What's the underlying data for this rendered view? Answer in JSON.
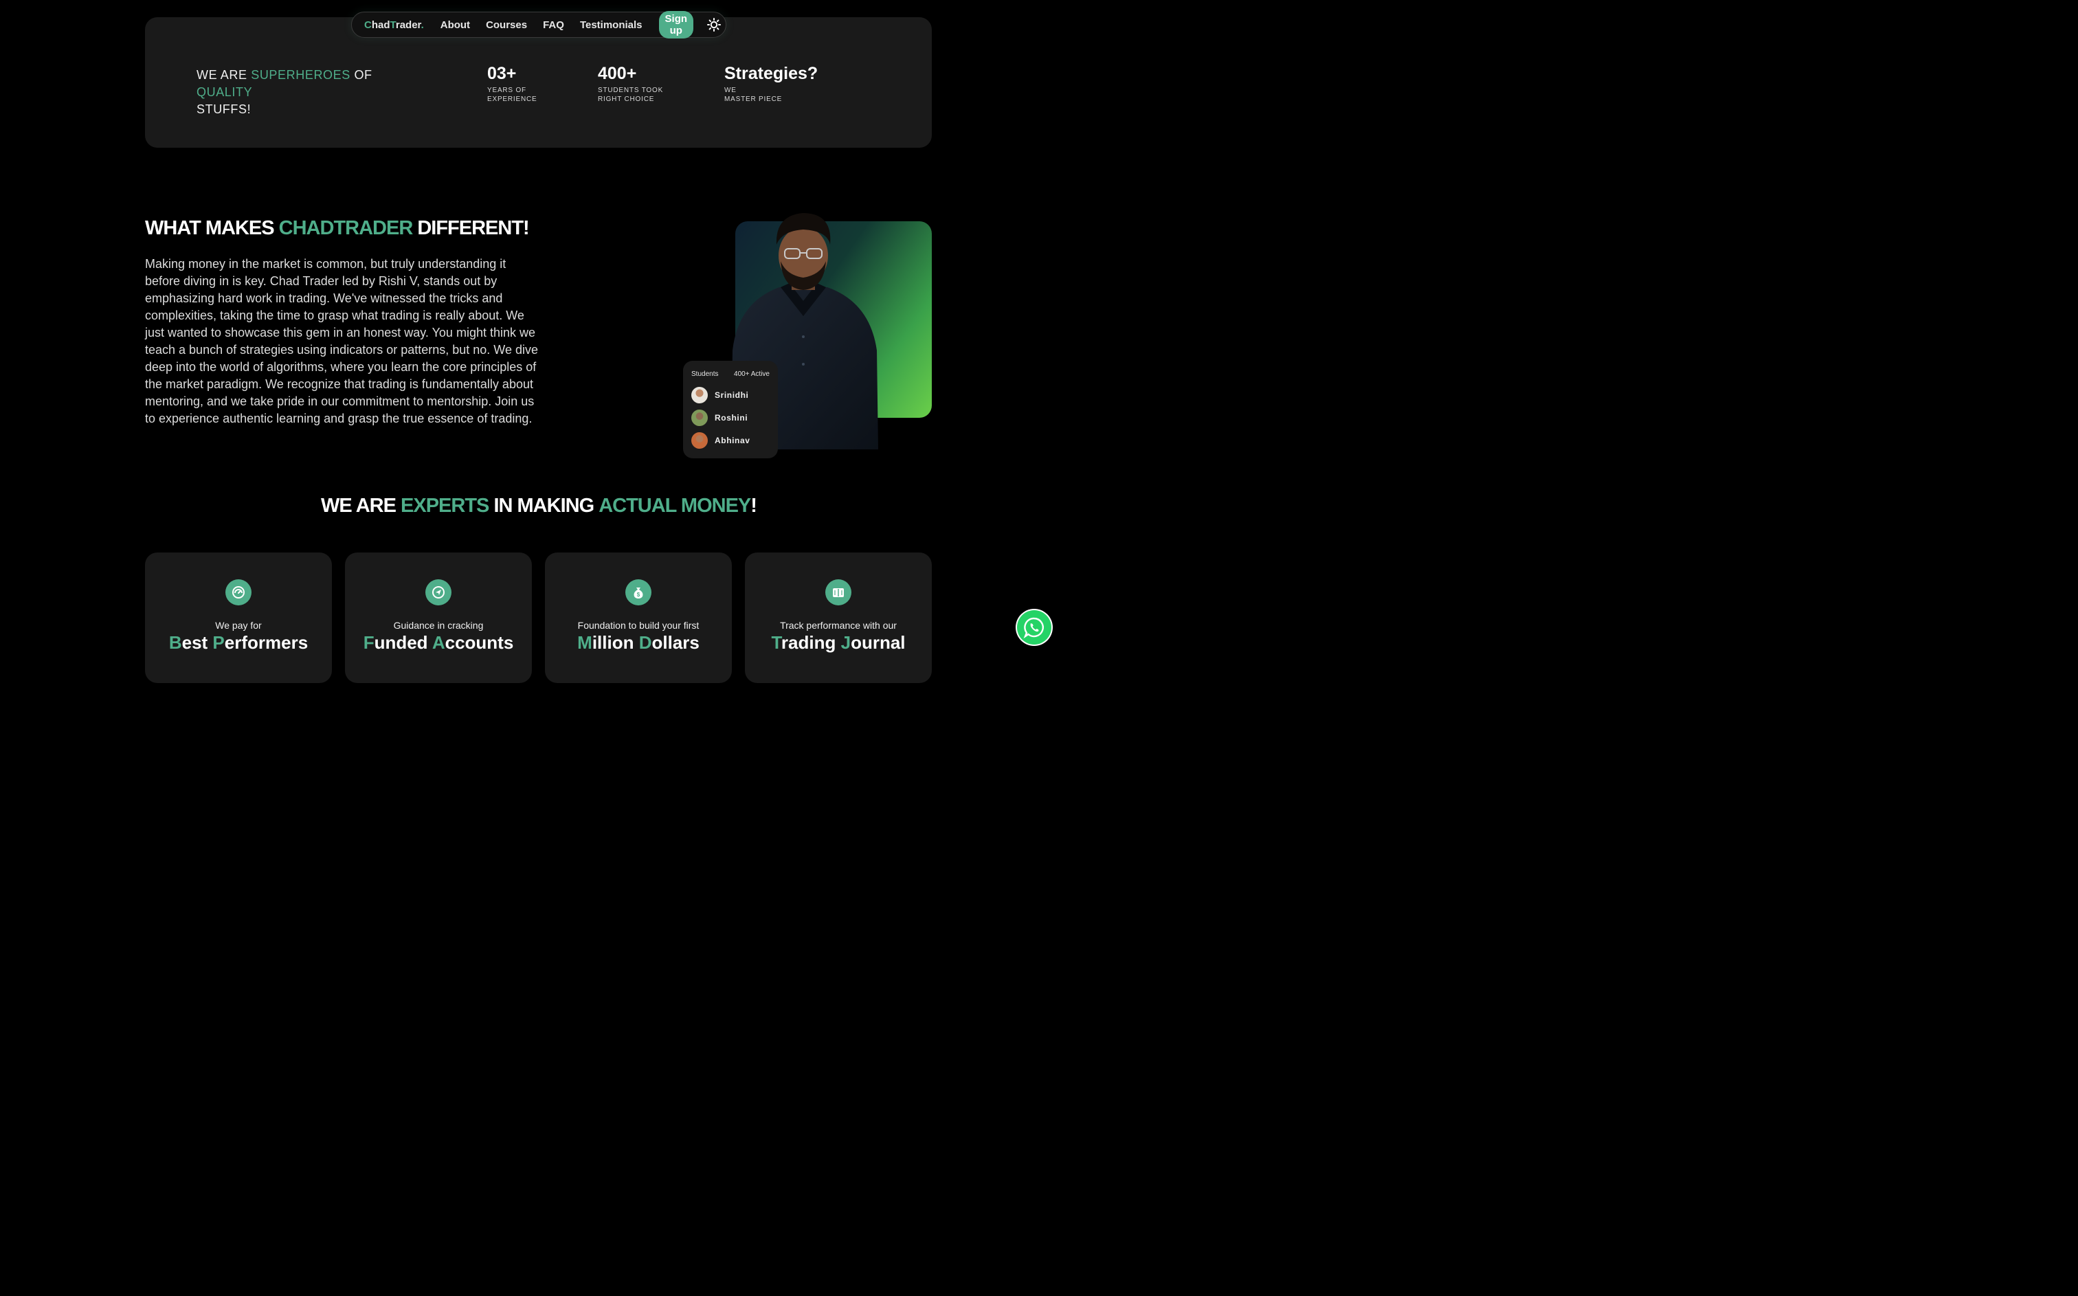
{
  "nav": {
    "logo_c": "C",
    "logo_had": "had",
    "logo_t": "T",
    "logo_rader": "rader",
    "logo_dot": ".",
    "items": [
      "About",
      "Courses",
      "FAQ",
      "Testimonials"
    ],
    "signup": "Sign up",
    "theme_icon": "sun-icon"
  },
  "hero": {
    "tag_we_are": "WE ARE ",
    "tag_superheroes": "SUPERHEROES",
    "tag_of": " OF ",
    "tag_quality": "QUALITY",
    "tag_stuffs": "STUFFS!",
    "stats": [
      {
        "value": "03+",
        "label": "YEARS OF\nEXPERIENCE"
      },
      {
        "value": "400+",
        "label": "STUDENTS TOOK\nRIGHT CHOICE"
      },
      {
        "value": "Strategies?",
        "label": "WE\nMASTER PIECE"
      }
    ]
  },
  "about": {
    "title_pre": "WHAT MAKES ",
    "title_brand": "CHADTRADER",
    "title_post": " DIFFERENT!",
    "body": "Making money in the market is common, but truly understanding it before diving in is key. Chad Trader led by Rishi V, stands out by emphasizing hard work in trading. We've witnessed the tricks and complexities, taking the time to grasp what trading is really about. We just wanted to showcase this gem in an honest way. You might think we teach a bunch of strategies using indicators or patterns, but no. We dive deep into the world of algorithms, where you learn the core principles of the market paradigm. We recognize that trading is fundamentally about mentoring, and we take pride in our commitment to mentorship. Join us to experience authentic learning and grasp the true essence of trading.",
    "students_card": {
      "title": "Students",
      "active": "400+ Active",
      "students": [
        "Srinidhi",
        "Roshini",
        "Abhinav"
      ]
    }
  },
  "experts": {
    "pre": "WE ARE ",
    "experts": "EXPERTS",
    "mid": " IN MAKING ",
    "money": "ACTUAL MONEY",
    "end": "!"
  },
  "features": [
    {
      "icon": "gauge-icon",
      "small": "We pay for",
      "w1_first": "B",
      "w1_rest": "est ",
      "w2_first": "P",
      "w2_rest": "erformers"
    },
    {
      "icon": "paper-plane-icon",
      "small": "Guidance in cracking",
      "w1_first": "F",
      "w1_rest": "unded ",
      "w2_first": "A",
      "w2_rest": "ccounts"
    },
    {
      "icon": "money-bag-icon",
      "small": "Foundation to build your first",
      "w1_first": "M",
      "w1_rest": "illion ",
      "w2_first": "D",
      "w2_rest": "ollars"
    },
    {
      "icon": "book-icon",
      "small": "Track performance with our",
      "w1_first": "T",
      "w1_rest": "rading ",
      "w2_first": "J",
      "w2_rest": "ournal"
    }
  ],
  "colors": {
    "accent": "#4fae8a",
    "card": "#1a1a1a",
    "background": "#000000",
    "whatsapp": "#25d366"
  }
}
